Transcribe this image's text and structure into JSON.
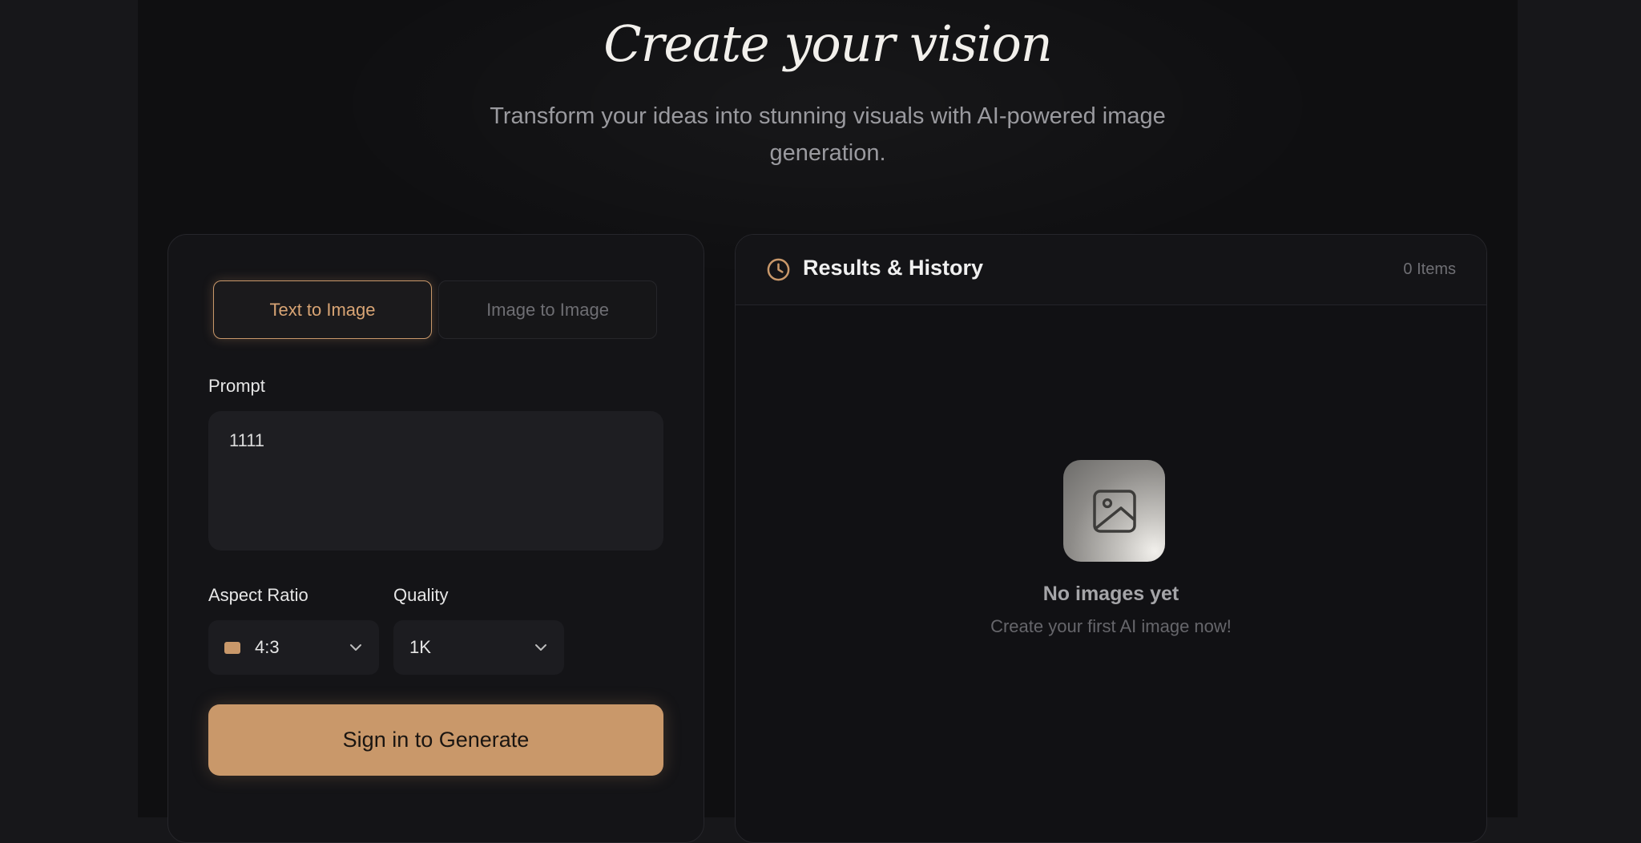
{
  "hero": {
    "title": "Create your vision",
    "subtitle": "Transform your ideas into stunning visuals with AI-powered image generation."
  },
  "generator": {
    "tabs": [
      {
        "label": "Text to Image",
        "active": true
      },
      {
        "label": "Image to Image",
        "active": false
      }
    ],
    "prompt_label": "Prompt",
    "prompt_value": "1111",
    "aspect_ratio_label": "Aspect Ratio",
    "aspect_ratio_value": "4:3",
    "quality_label": "Quality",
    "quality_value": "1K",
    "generate_label": "Sign in to Generate"
  },
  "results": {
    "title": "Results & History",
    "count": "0 Items",
    "empty_title": "No images yet",
    "empty_subtitle": "Create your first AI image now!"
  },
  "colors": {
    "accent": "#c9986a",
    "background": "#0f0f11",
    "panel": "#141417"
  },
  "icons": [
    "clock-icon",
    "chevron-down-icon",
    "image-placeholder-icon",
    "aspect-ratio-swatch"
  ]
}
